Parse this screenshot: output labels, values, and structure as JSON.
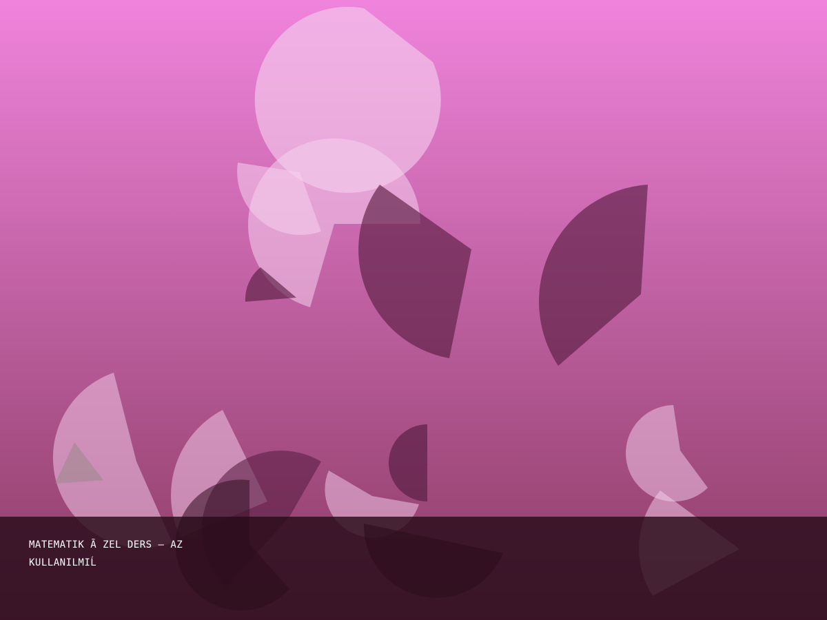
{
  "caption": {
    "line1": "MATEMATIK Ã ZEL DERS – AZ",
    "line2": "KULLANILMIĹ"
  },
  "colors": {
    "background_top": "#f084dc",
    "background_bottom": "#8a3a62",
    "light_shape": "#f5d0ee",
    "dark_shape": "#5a1f44",
    "caption_bar": "#2a0d1c",
    "caption_text": "#ffffff"
  }
}
